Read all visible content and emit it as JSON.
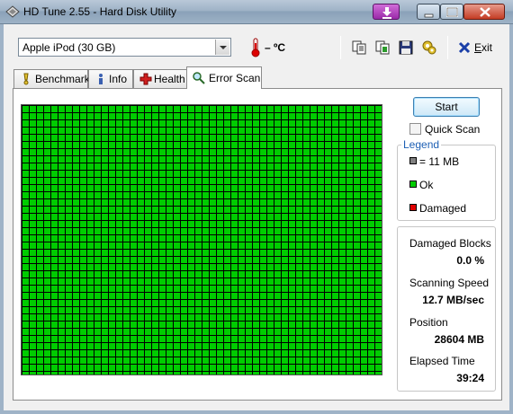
{
  "window": {
    "title": "HD Tune 2.55 - Hard Disk Utility",
    "title_bar_color": "#9fb3c7"
  },
  "toolbar": {
    "drive": "Apple   iPod (30 GB)",
    "temperature": "– ºC",
    "icons": [
      "copy-text-icon",
      "copy-image-icon",
      "save-icon",
      "options-icon",
      "exit-icon"
    ],
    "exit_label_prefix": "E",
    "exit_label_suffix": "xit"
  },
  "tabs": [
    {
      "label": "Benchmark",
      "icon": "benchmark-icon"
    },
    {
      "label": "Info",
      "icon": "info-icon"
    },
    {
      "label": "Health",
      "icon": "health-icon"
    },
    {
      "label": "Error Scan",
      "icon": "magnifier-icon",
      "active": true
    }
  ],
  "scan": {
    "start_label": "Start",
    "quick_scan_label": "Quick Scan",
    "quick_scan_checked": false,
    "block_status": "all ok",
    "ok_color": "#00cc00",
    "damaged_color": "#e00000"
  },
  "legend": {
    "title": "Legend",
    "items": [
      {
        "label": "= 11 MB",
        "color": "#808080"
      },
      {
        "label": "Ok",
        "color": "#00cc00"
      },
      {
        "label": "Damaged",
        "color": "#e00000"
      }
    ]
  },
  "stats": {
    "damaged_blocks_label": "Damaged Blocks",
    "damaged_blocks_value": "0.0 %",
    "scanning_speed_label": "Scanning Speed",
    "scanning_speed_value": "12.7 MB/sec",
    "position_label": "Position",
    "position_value": "28604 MB",
    "elapsed_label": "Elapsed Time",
    "elapsed_value": "39:24"
  }
}
